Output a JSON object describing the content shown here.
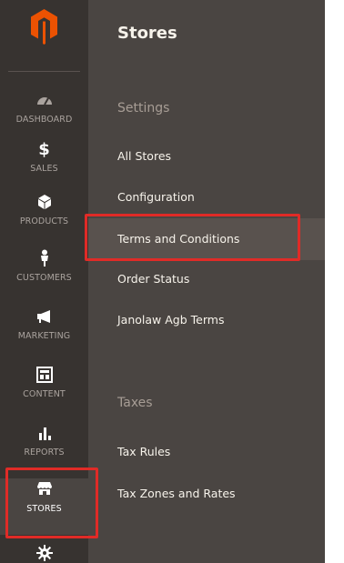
{
  "nav": {
    "items": [
      {
        "label": "DASHBOARD",
        "icon": "dashboard-icon"
      },
      {
        "label": "SALES",
        "icon": "dollar-icon"
      },
      {
        "label": "PRODUCTS",
        "icon": "cube-icon"
      },
      {
        "label": "CUSTOMERS",
        "icon": "person-icon"
      },
      {
        "label": "MARKETING",
        "icon": "megaphone-icon"
      },
      {
        "label": "CONTENT",
        "icon": "layout-icon"
      },
      {
        "label": "REPORTS",
        "icon": "bar-chart-icon"
      },
      {
        "label": "STORES",
        "icon": "store-icon"
      }
    ]
  },
  "flyout": {
    "title": "Stores",
    "settings": {
      "title": "Settings",
      "links": [
        "All Stores",
        "Configuration",
        "Terms and Conditions",
        "Order Status",
        "Janolaw Agb Terms"
      ]
    },
    "taxes": {
      "title": "Taxes",
      "links": [
        "Tax Rules",
        "Tax Zones and Rates"
      ]
    }
  },
  "colors": {
    "nav_bg": "#373330",
    "flyout_bg": "#4a4542",
    "logo_orange": "#eb5202",
    "annotation_red": "#e02b27"
  }
}
